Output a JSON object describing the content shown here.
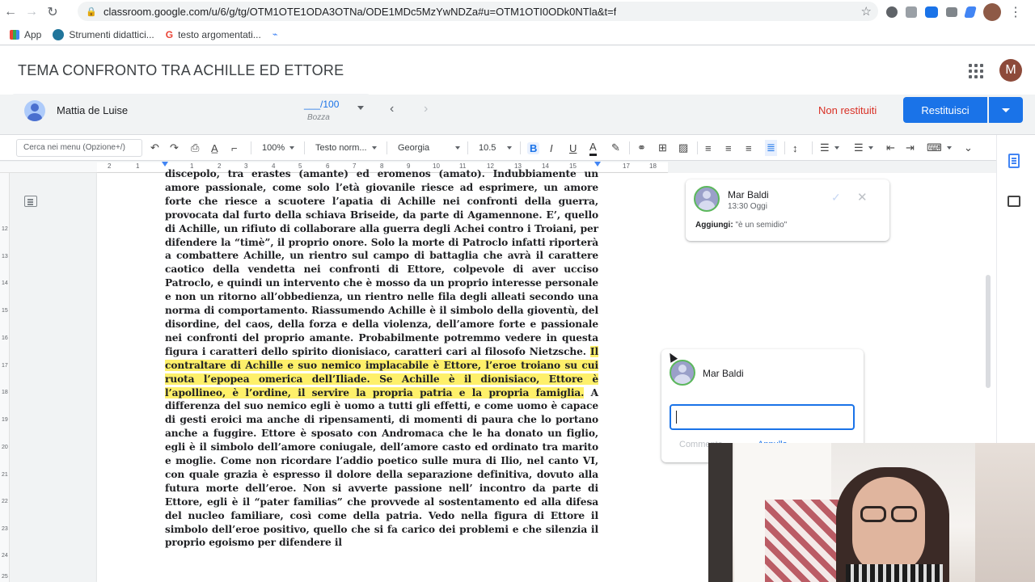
{
  "browser": {
    "url": "classroom.google.com/u/6/g/tg/OTM1OTE1ODA3OTNa/ODE1MDc5MzYwNDZa#u=OTM1OTI0ODk0NTla&t=f",
    "bookmarks": [
      {
        "label": "App"
      },
      {
        "label": "Strumenti didattici..."
      },
      {
        "label": "testo argomentati..."
      }
    ]
  },
  "header": {
    "title": "TEMA CONFRONTO TRA ACHILLE ED ETTORE",
    "avatar_letter": "M"
  },
  "student": {
    "name": "Mattia de Luise",
    "grade": "___/100",
    "grade_status": "Bozza"
  },
  "actions": {
    "not_returned": "Non restituiti",
    "return_label": "Restituisci"
  },
  "toolbar": {
    "search_placeholder": "Cerca nei menu (Opzione+/)",
    "zoom": "100%",
    "style": "Testo norm...",
    "font": "Georgia",
    "size": "10.5"
  },
  "ruler": [
    "2",
    "1",
    "1",
    "2",
    "3",
    "4",
    "5",
    "6",
    "7",
    "8",
    "9",
    "10",
    "11",
    "12",
    "13",
    "14",
    "15",
    "16",
    "17",
    "18"
  ],
  "vruler": [
    "12",
    "13",
    "14",
    "15",
    "16",
    "17",
    "18",
    "19",
    "20",
    "21",
    "22",
    "23",
    "24",
    "25"
  ],
  "document": {
    "before_highlight": "discepolo, tra erastes (amante) ed eromenos (amato). Indubbiamente un amore passionale, come solo l’età giovanile riesce ad esprimere, un amore forte che riesce a scuotere l’apatia di Achille nei confronti della guerra, provocata dal furto della schiava Briseide, da parte di Agamennone. E’, quello di Achille, un rifiuto di collaborare alla guerra degli Achei contro i Troiani, per difendere la “timè”, il proprio onore. Solo la morte di Patroclo infatti riporterà a combattere Achille, un rientro sul campo di battaglia che avrà il carattere caotico della vendetta nei confronti di Ettore, colpevole di aver ucciso Patroclo, e quindi un intervento che è mosso da un proprio interesse personale e non un ritorno all’obbedienza, un rientro nelle fila degli alleati secondo una norma di comportamento. Riassumendo Achille è il simbolo della gioventù, del disordine, del caos, della forza e della violenza, dell’amore forte e passionale nei confronti del proprio amante. Probabilmente potremmo vedere in questa figura i caratteri dello spirito dionisiaco, caratteri cari al filosofo Nietzsche. ",
    "highlight": "Il contraltare di Achille e suo nemico implacabile è Ettore, l’eroe troiano su cui ruota l’epopea omerica dell’Iliade. Se Achille è il dionisiaco, Ettore è l’apollineo, è l’ordine, il servire la propria patria e la propria famiglia.",
    "after_highlight": " A differenza del suo nemico egli è uomo a tutti gli effetti, e come uomo è capace di gesti eroici ma anche di ripensamenti, di momenti di paura che lo portano anche a fuggire. Ettore è sposato con Andromaca che le ha donato un figlio, egli è il simbolo dell’amore coniugale, dell’amore casto ed ordinato tra marito e moglie.  Come non ricordare l’addio poetico sulle mura di Ilio, nel canto VI, con quale grazia è espresso il dolore della separazione definitiva, dovuto alla futura morte dell’eroe.  Non si avverte passione nell’ incontro da parte di Ettore, egli è il “pater familias” che provvede al sostentamento ed alla difesa del nucleo familiare, così come della patria. Vedo nella figura di Ettore il simbolo dell’eroe positivo, quello che si fa carico dei problemi e che silenzia il proprio egoismo per difendere il"
  },
  "comments": {
    "first": {
      "author": "Mar Baldi",
      "time": "13:30 Oggi",
      "action": "Aggiungi:",
      "text": "\"è un semidio\""
    },
    "reply": {
      "author": "Mar Baldi",
      "comment_label": "Commenta",
      "cancel_label": "Annulla"
    }
  },
  "colors": {
    "primary": "#1a73e8",
    "alert": "#d93025",
    "highlight": "#fef06a"
  }
}
